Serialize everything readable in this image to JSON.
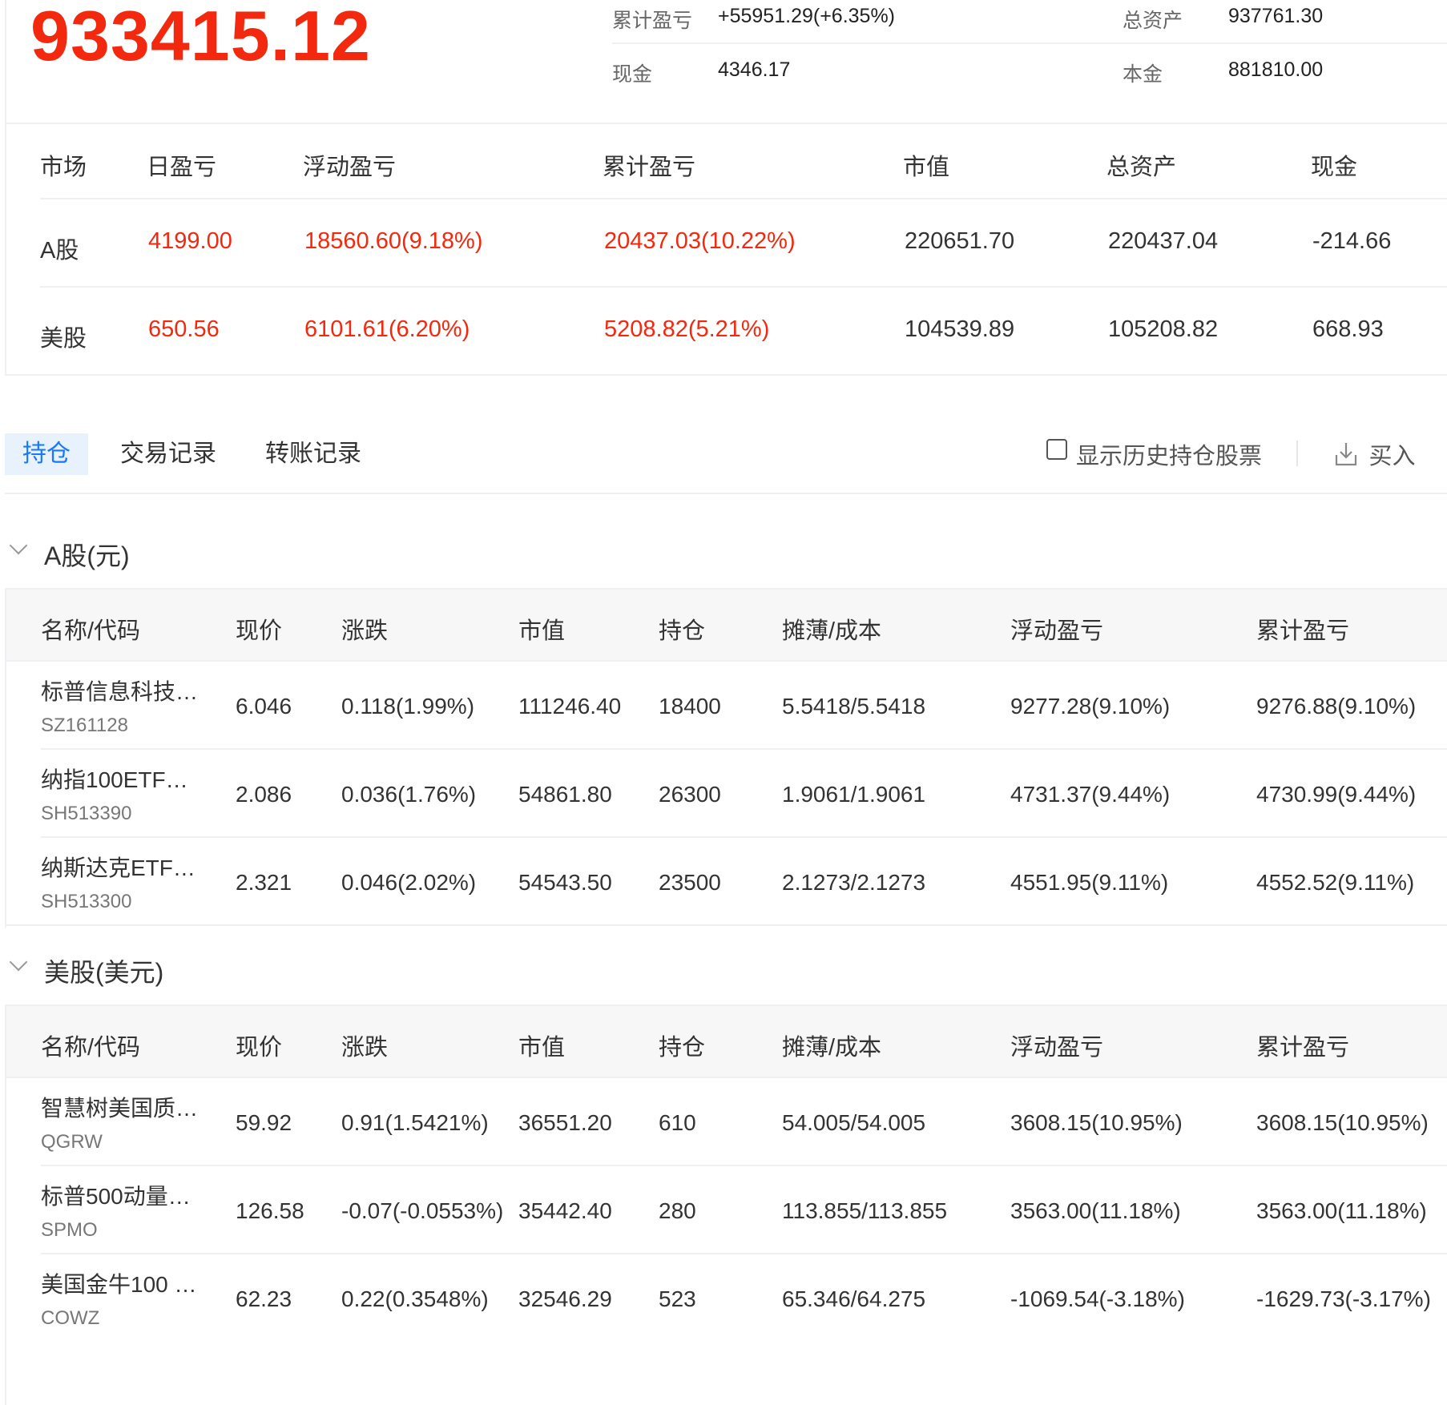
{
  "summary": {
    "total": "933415.12",
    "items": [
      {
        "label": "累计盈亏",
        "value": "+55951.29(+6.35%)",
        "color": "red"
      },
      {
        "label": "总资产",
        "value": "937761.30"
      },
      {
        "label": "现金",
        "value": "4346.17"
      },
      {
        "label": "本金",
        "value": "881810.00"
      }
    ]
  },
  "market_table": {
    "headers": [
      "市场",
      "日盈亏",
      "浮动盈亏",
      "累计盈亏",
      "市值",
      "总资产",
      "现金"
    ],
    "rows": [
      [
        "A股",
        "4199.00",
        "18560.60(9.18%)",
        "20437.03(10.22%)",
        "220651.70",
        "220437.04",
        "-214.66"
      ],
      [
        "美股",
        "650.56",
        "6101.61(6.20%)",
        "5208.82(5.21%)",
        "104539.89",
        "105208.82",
        "668.93"
      ]
    ]
  },
  "tabs": [
    {
      "label": "持仓",
      "active": true
    },
    {
      "label": "交易记录"
    },
    {
      "label": "转账记录"
    }
  ],
  "toolbar": {
    "show_history_label": "显示历史持仓股票",
    "buy_label": "买入"
  },
  "holdings_headers": [
    "名称/代码",
    "现价",
    "涨跌",
    "市值",
    "持仓",
    "摊薄/成本",
    "浮动盈亏",
    "累计盈亏"
  ],
  "sections": [
    {
      "title": "A股(元)",
      "rows": [
        {
          "name": "标普信息科技…",
          "code": "SZ161128",
          "price": "6.046",
          "change": "0.118(1.99%)",
          "mv": "111246.40",
          "qty": "18400",
          "cost": "5.5418/5.5418",
          "float": "9277.28(9.10%)",
          "cum": "9276.88(9.10%)",
          "c": [
            "red",
            "red",
            "red"
          ]
        },
        {
          "name": "纳指100ETF…",
          "code": "SH513390",
          "price": "2.086",
          "change": "0.036(1.76%)",
          "mv": "54861.80",
          "qty": "26300",
          "cost": "1.9061/1.9061",
          "float": "4731.37(9.44%)",
          "cum": "4730.99(9.44%)",
          "c": [
            "red",
            "red",
            "red"
          ]
        },
        {
          "name": "纳斯达克ETF…",
          "code": "SH513300",
          "price": "2.321",
          "change": "0.046(2.02%)",
          "mv": "54543.50",
          "qty": "23500",
          "cost": "2.1273/2.1273",
          "float": "4551.95(9.11%)",
          "cum": "4552.52(9.11%)",
          "c": [
            "red",
            "red",
            "red"
          ]
        }
      ]
    },
    {
      "title": "美股(美元)",
      "rows": [
        {
          "name": "智慧树美国质…",
          "code": "QGRW",
          "price": "59.92",
          "change": "0.91(1.5421%)",
          "mv": "36551.20",
          "qty": "610",
          "cost": "54.005/54.005",
          "float": "3608.15(10.95%)",
          "cum": "3608.15(10.95%)",
          "c": [
            "red",
            "red",
            "red"
          ]
        },
        {
          "name": "标普500动量…",
          "code": "SPMO",
          "price": "126.58",
          "change": "-0.07(-0.0553%)",
          "mv": "35442.40",
          "qty": "280",
          "cost": "113.855/113.855",
          "float": "3563.00(11.18%)",
          "cum": "3563.00(11.18%)",
          "c": [
            "green",
            "red",
            "red"
          ]
        },
        {
          "name": "美国金牛100 …",
          "code": "COWZ",
          "price": "62.23",
          "change": "0.22(0.3548%)",
          "mv": "32546.29",
          "qty": "523",
          "cost": "65.346/64.275",
          "float": "-1069.54(-3.18%)",
          "cum": "-1629.73(-3.17%)",
          "c": [
            "red",
            "green",
            "green"
          ]
        }
      ]
    }
  ],
  "colors": {
    "red": "#f2290f",
    "green": "#17a03a",
    "accent": "#1677ff"
  }
}
